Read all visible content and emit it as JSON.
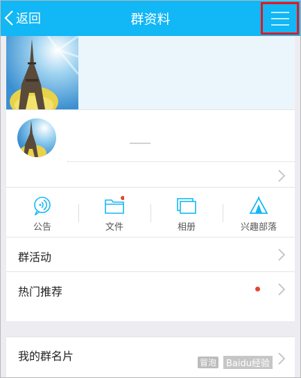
{
  "header": {
    "back_label": "返回",
    "title": "群资料",
    "menu_icon": "hamburger-menu-icon",
    "bg_color": "#12b7f5",
    "highlight_color": "#e8151d"
  },
  "actions": [
    {
      "label": "公告",
      "icon": "announcement-icon"
    },
    {
      "label": "文件",
      "icon": "folder-icon"
    },
    {
      "label": "相册",
      "icon": "album-icon"
    },
    {
      "label": "兴趣部落",
      "icon": "tribe-tent-icon"
    }
  ],
  "rows": {
    "activity": "群活动",
    "hot": "热门推荐",
    "card": "我的群名片"
  },
  "watermark": {
    "badge": "冒泡",
    "text": "Baidu经验"
  }
}
